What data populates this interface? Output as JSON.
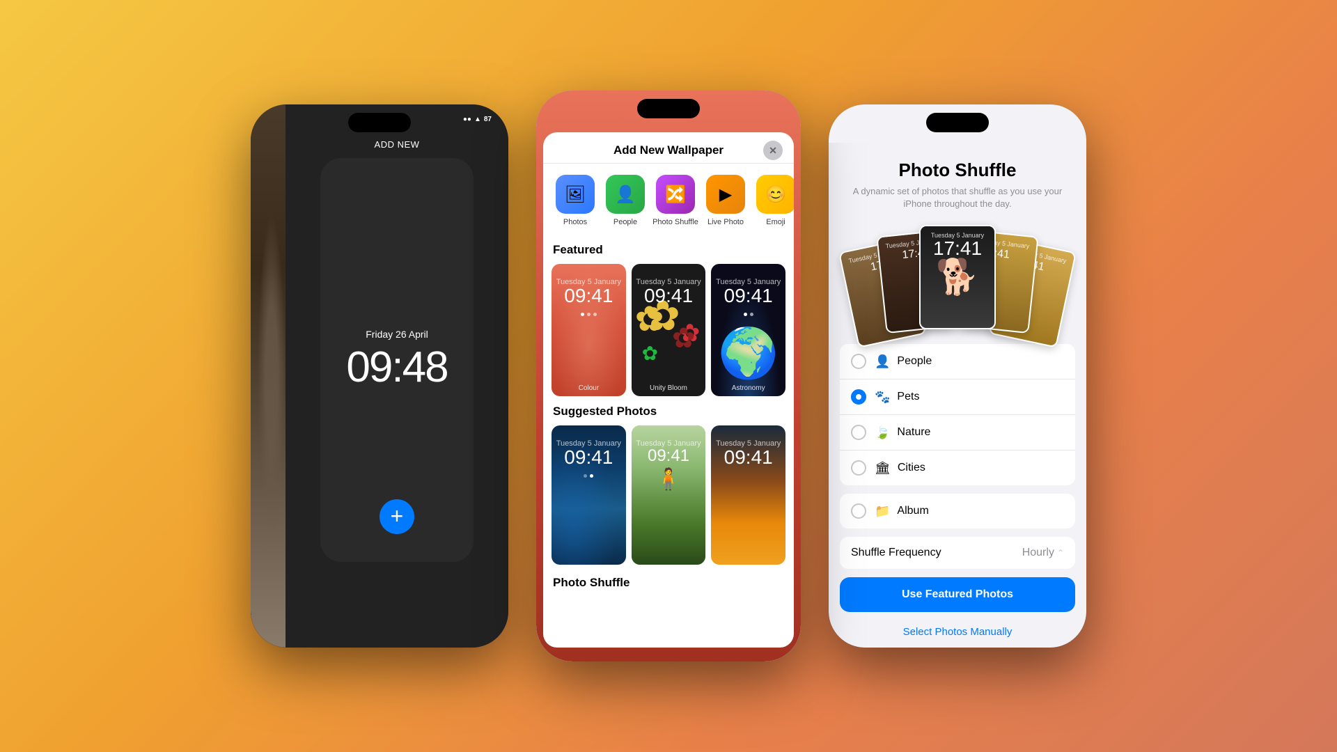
{
  "background": {
    "gradient": "linear-gradient(135deg, #f5c842, #f0a030, #e8804a, #d4785a)"
  },
  "phone1": {
    "add_new_label": "ADD NEW",
    "date": "Friday 26 April",
    "time": "09:48",
    "status": {
      "signal": "●●●",
      "wifi": "wifi",
      "battery": "87"
    }
  },
  "phone2": {
    "modal_title": "Add New Wallpaper",
    "close_label": "✕",
    "wallpaper_types": [
      {
        "id": "photos",
        "label": "Photos",
        "icon": "🖼"
      },
      {
        "id": "people",
        "label": "People",
        "icon": "👤"
      },
      {
        "id": "shuffle",
        "label": "Photo Shuffle",
        "icon": "🔀"
      },
      {
        "id": "live",
        "label": "Live Photo",
        "icon": "▶"
      },
      {
        "id": "emoji",
        "label": "Emoji",
        "icon": "😊"
      }
    ],
    "featured_label": "Featured",
    "featured_wallpapers": [
      {
        "id": "colour",
        "label": "Colour"
      },
      {
        "id": "unity",
        "label": "Unity Bloom"
      },
      {
        "id": "astronomy",
        "label": "Astronomy"
      }
    ],
    "suggested_label": "Suggested Photos",
    "suggested_photos": [
      {
        "id": "underwater",
        "label": ""
      },
      {
        "id": "person",
        "label": ""
      },
      {
        "id": "sunset",
        "label": ""
      }
    ],
    "photo_shuffle_label": "Photo Shuffle",
    "time_display": "09:41",
    "date_display": "Tuesday 5 January"
  },
  "phone3": {
    "title": "Photo Shuffle",
    "subtitle": "A dynamic set of photos that shuffle as you use your iPhone throughout the day.",
    "categories": [
      {
        "id": "people",
        "label": "People",
        "icon": "👤",
        "checked": false
      },
      {
        "id": "pets",
        "label": "Pets",
        "icon": "🐾",
        "checked": true
      },
      {
        "id": "nature",
        "label": "Nature",
        "icon": "🍃",
        "checked": false
      },
      {
        "id": "cities",
        "label": "Cities",
        "icon": "🏛",
        "checked": false
      },
      {
        "id": "album",
        "label": "Album",
        "icon": "📁",
        "checked": false
      }
    ],
    "shuffle_frequency_label": "Shuffle Frequency",
    "shuffle_frequency_value": "Hourly",
    "use_featured_btn": "Use Featured Photos",
    "select_manual_link": "Select Photos Manually",
    "time_display": "17:41"
  }
}
